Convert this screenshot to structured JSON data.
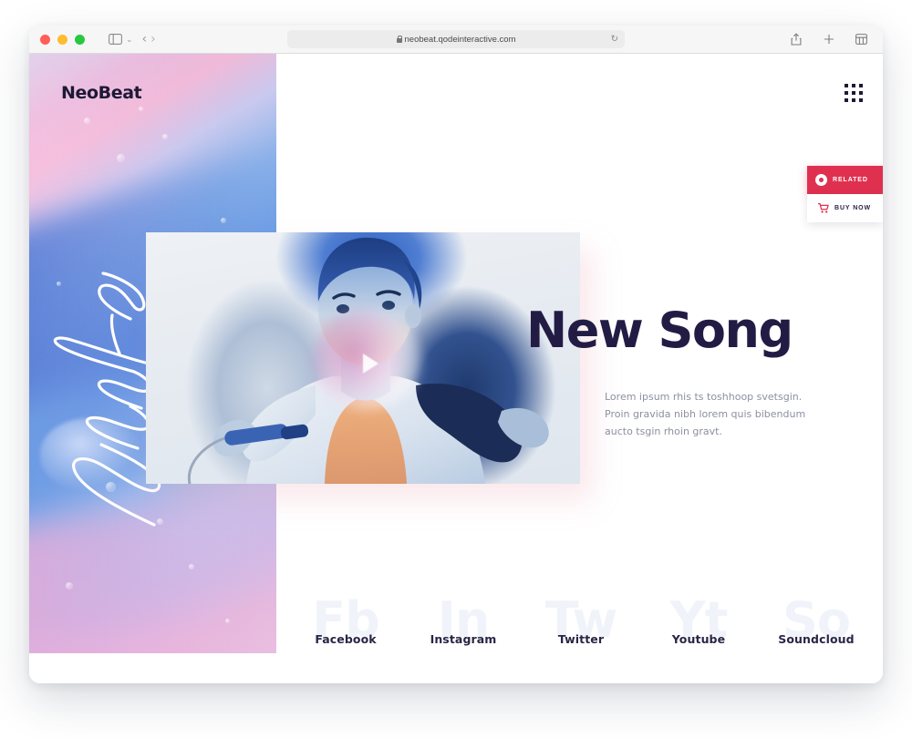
{
  "browser": {
    "url": "neobeat.qodeinteractive.com",
    "lock_icon": "lock-icon",
    "reload_glyph": "↻",
    "traffic_lights": [
      "close",
      "minimize",
      "maximize"
    ],
    "sidebar_icon": "sidebar-toggle-icon",
    "sidebar_chevron": "⌄",
    "back_glyph": "‹",
    "forward_glyph": "›",
    "reader_icon": "contrast-reader-icon",
    "share_icon": "share-icon",
    "newtab_glyph": "+",
    "tabs_icon": "tab-overview-icon"
  },
  "site": {
    "brand": "NeoBeat",
    "menu_icon": "grid-menu-icon",
    "signature_text": "True Love"
  },
  "side_actions": [
    {
      "label": "RELATED",
      "icon": "vinyl-record-icon",
      "style": "primary",
      "color": "#e03050"
    },
    {
      "label": "BUY NOW",
      "icon": "shopping-cart-icon",
      "style": "light",
      "color": "#ffffff"
    }
  ],
  "hero": {
    "title": "New Song",
    "paragraph": "Lorem ipsum rhis ts toshhoop svetsgin. Proin gravida nibh lorem quis bibendum aucto tsgin rhoin gravt.",
    "play_icon": "play-button-icon",
    "title_color": "#221c45",
    "paragraph_color": "#8c90a0"
  },
  "social": [
    {
      "label": "Facebook",
      "watermark": "Fb"
    },
    {
      "label": "Instagram",
      "watermark": "In"
    },
    {
      "label": "Twitter",
      "watermark": "Tw"
    },
    {
      "label": "Youtube",
      "watermark": "Yt"
    },
    {
      "label": "Soundcloud",
      "watermark": "So"
    }
  ],
  "colors": {
    "accent": "#e03050",
    "dark": "#221c45",
    "watermark": "#f0f3f9",
    "toolbar": "#f6f6f6"
  }
}
